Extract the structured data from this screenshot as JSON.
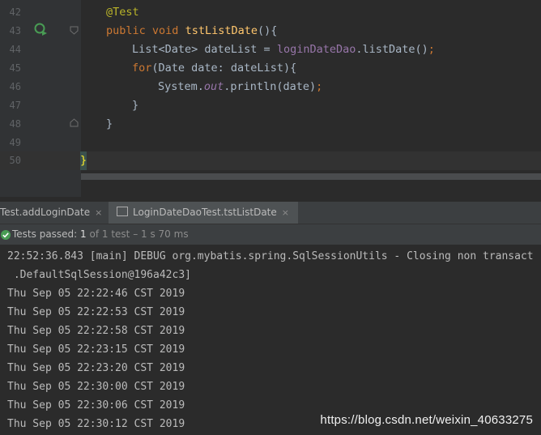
{
  "editor": {
    "line_numbers": [
      "42",
      "43",
      "44",
      "45",
      "46",
      "47",
      "48",
      "49",
      "50"
    ],
    "annotation": "@Test",
    "method_kw_public": "public",
    "method_kw_void": "void",
    "method_name": "tstListDate",
    "method_paren": "(){",
    "stmt1_type": "List<Date> dateList = ",
    "stmt1_field": "loginDateDao",
    "stmt1_rest": ".listDate()",
    "stmt1_semicolon": ";",
    "for_kw": "for",
    "for_rest": "(Date date: dateList){",
    "print_sys": "System.",
    "print_out": "out",
    "print_rest": ".println(date)",
    "print_semi": ";",
    "close_inner": "}",
    "close_method": "}",
    "close_class": "}"
  },
  "run_tabs": [
    {
      "label": "Test.addLoginDate",
      "close": "×"
    },
    {
      "label": "LoginDateDaoTest.tstListDate",
      "close": "×"
    }
  ],
  "test_status": {
    "label": "Tests passed:",
    "count": "1",
    "of_text": "of 1 test",
    "duration": "– 1 s 70 ms"
  },
  "console": {
    "lines": [
      "22:52:36.843 [main] DEBUG org.mybatis.spring.SqlSessionUtils - Closing non transact",
      " .DefaultSqlSession@196a42c3]",
      "Thu Sep 05 22:22:46 CST 2019",
      "Thu Sep 05 22:22:53 CST 2019",
      "Thu Sep 05 22:22:58 CST 2019",
      "Thu Sep 05 22:23:15 CST 2019",
      "Thu Sep 05 22:23:20 CST 2019",
      "Thu Sep 05 22:30:00 CST 2019",
      "Thu Sep 05 22:30:06 CST 2019",
      "Thu Sep 05 22:30:12 CST 2019"
    ]
  },
  "watermark": "https://blog.csdn.net/weixin_40633275",
  "colors": {
    "background": "#2b2b2b",
    "keyword": "#cc7832",
    "annotation": "#bbb529",
    "method": "#ffc66d",
    "field": "#9876aa",
    "pass_green": "#499c54"
  },
  "icons": [
    "run-test-icon",
    "fold-icon",
    "check-icon",
    "console-tab-icon"
  ]
}
